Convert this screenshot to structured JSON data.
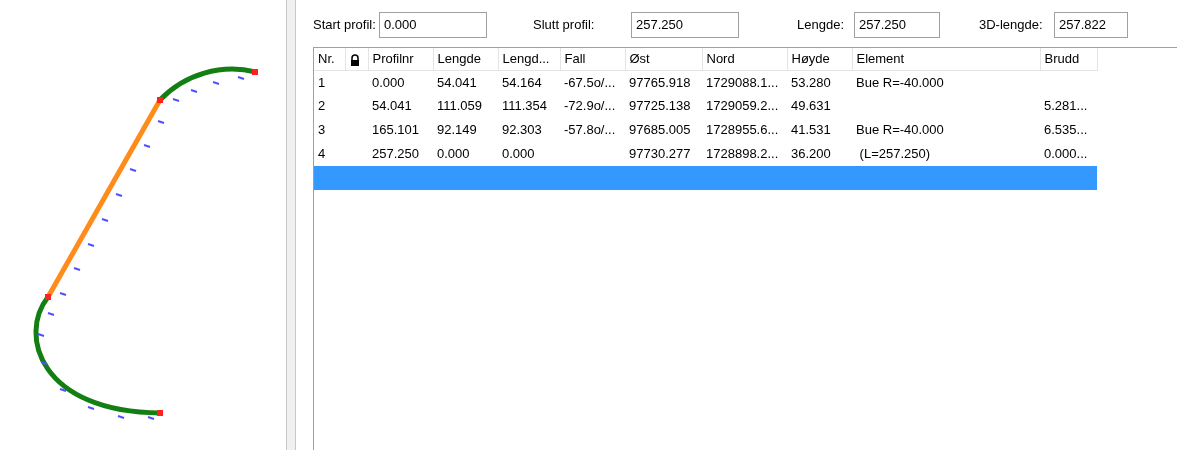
{
  "fields": [
    {
      "label": "Start profil:",
      "value": "0.000"
    },
    {
      "label": "Slutt profil:",
      "value": "257.250"
    },
    {
      "label": "Lengde:",
      "value": "257.250"
    },
    {
      "label": "3D-lengde:",
      "value": "257.822"
    }
  ],
  "table": {
    "columns": [
      {
        "kind": "text",
        "label": "Nr."
      },
      {
        "kind": "icon"
      },
      {
        "kind": "text",
        "label": "Profilnr"
      },
      {
        "kind": "text",
        "label": "Lengde"
      },
      {
        "kind": "text",
        "label": "Lengd..."
      },
      {
        "kind": "text",
        "label": "Fall"
      },
      {
        "kind": "text",
        "label": "Øst"
      },
      {
        "kind": "text",
        "label": "Nord"
      },
      {
        "kind": "text",
        "label": "Høyde"
      },
      {
        "kind": "text",
        "label": "Element"
      },
      {
        "kind": "text",
        "label": "Brudd"
      }
    ],
    "rows": [
      {
        "selected": false,
        "cells": [
          "1",
          null,
          "0.000",
          "54.041",
          "54.164",
          "-67.5o/...",
          "97765.918",
          "1729088.1...",
          "53.280",
          "Bue R=-40.000",
          null
        ]
      },
      {
        "selected": false,
        "cells": [
          "2",
          null,
          "54.041",
          "111.059",
          "111.354",
          "-72.9o/...",
          "97725.138",
          "1729059.2...",
          "49.631",
          null,
          "5.281..."
        ]
      },
      {
        "selected": false,
        "cells": [
          "3",
          null,
          "165.101",
          "92.149",
          "92.303",
          "-57.8o/...",
          "97685.005",
          "1728955.6...",
          "41.531",
          "Bue R=-40.000",
          "6.535..."
        ]
      },
      {
        "selected": false,
        "cells": [
          "4",
          null,
          "257.250",
          "0.000",
          "0.000",
          null,
          "97730.277",
          "1728898.2...",
          "36.200",
          " (L=257.250)",
          "0.000..."
        ]
      },
      {
        "selected": true,
        "cells": []
      }
    ]
  }
}
